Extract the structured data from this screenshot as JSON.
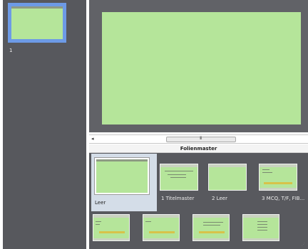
{
  "slide_panel": {
    "slides": [
      {
        "number": "1"
      }
    ]
  },
  "editor": {
    "scrollbar_left_arrow": "◂",
    "scrollbar_grip": "III"
  },
  "master_panel": {
    "title": "Folienmaster",
    "selected_label": "Leer",
    "layouts": [
      {
        "label": "1 Titelmaster"
      },
      {
        "label": "2 Leer"
      },
      {
        "label": "3 MCQ, T/F, FIB..."
      }
    ]
  },
  "colors": {
    "slide_green": "#b5e59a",
    "selection_blue": "#6d9ae6",
    "panel_gray": "#57585d"
  }
}
